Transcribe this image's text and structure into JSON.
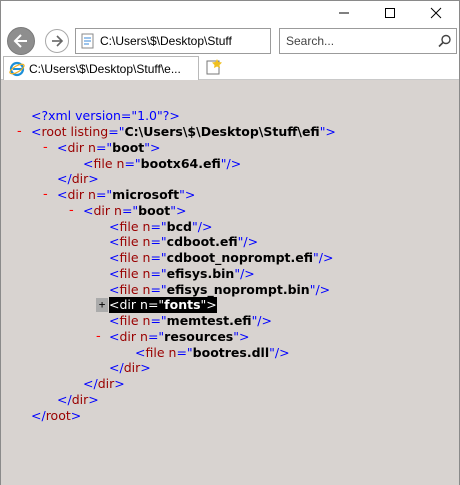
{
  "window": {
    "controls": [
      "minimize",
      "maximize",
      "close"
    ]
  },
  "nav": {
    "address": "C:\\Users\\$\\Desktop\\Stuff",
    "search_placeholder": "Search..."
  },
  "tab": {
    "title": "C:\\Users\\$\\Desktop\\Stuff\\e..."
  },
  "xml": {
    "decl": "<?xml version=\"1.0\"?>",
    "lines": [
      {
        "t": "<",
        "n": "root",
        "a": " listing=\"",
        "v": "C:\\Users\\$\\Desktop\\Stuff\\efi",
        "e": "\">"
      },
      {
        "t": "<",
        "n": "dir",
        "a": " n=\"",
        "v": "boot",
        "e": "\">"
      },
      {
        "t": "<",
        "n": "file",
        "a": " n=\"",
        "v": "bootx64.efi",
        "e": "\"/>"
      },
      {
        "t": "</",
        "n": "dir",
        "e": ">"
      },
      {
        "t": "<",
        "n": "dir",
        "a": " n=\"",
        "v": "microsoft",
        "e": "\">"
      },
      {
        "t": "<",
        "n": "dir",
        "a": " n=\"",
        "v": "boot",
        "e": "\">"
      },
      {
        "t": "<",
        "n": "file",
        "a": " n=\"",
        "v": "bcd",
        "e": "\"/>"
      },
      {
        "t": "<",
        "n": "file",
        "a": " n=\"",
        "v": "cdboot.efi",
        "e": "\"/>"
      },
      {
        "t": "<",
        "n": "file",
        "a": " n=\"",
        "v": "cdboot_noprompt.efi",
        "e": "\"/>"
      },
      {
        "t": "<",
        "n": "file",
        "a": " n=\"",
        "v": "efisys.bin",
        "e": "\"/>"
      },
      {
        "t": "<",
        "n": "file",
        "a": " n=\"",
        "v": "efisys_noprompt.bin",
        "e": "\"/>"
      },
      {
        "t": "<",
        "n": "dir",
        "a": " n=\"",
        "v": "fonts",
        "e": "\">"
      },
      {
        "t": "<",
        "n": "file",
        "a": " n=\"",
        "v": "memtest.efi",
        "e": "\"/>"
      },
      {
        "t": "<",
        "n": "dir",
        "a": " n=\"",
        "v": "resources",
        "e": "\">"
      },
      {
        "t": "<",
        "n": "file",
        "a": " n=\"",
        "v": "bootres.dll",
        "e": "\"/>"
      },
      {
        "t": "</",
        "n": "dir",
        "e": ">"
      },
      {
        "t": "</",
        "n": "dir",
        "e": ">"
      },
      {
        "t": "</",
        "n": "dir",
        "e": ">"
      },
      {
        "t": "</",
        "n": "root",
        "e": ">"
      }
    ],
    "collapse_symbol": "-",
    "expand_symbol": "+"
  }
}
